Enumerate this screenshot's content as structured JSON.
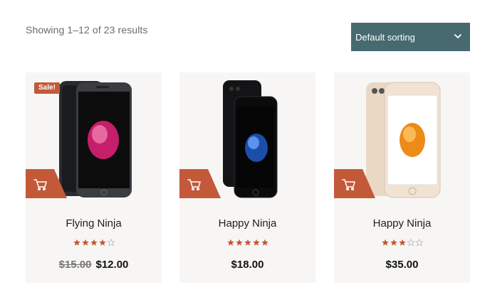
{
  "result_count": "Showing 1–12 of 23 results",
  "sort": {
    "selected": "Default sorting"
  },
  "colors": {
    "accent": "#c4593a",
    "sort_bg": "#476a70",
    "card_bg": "#f7f6f4"
  },
  "products": [
    {
      "name": "Flying Ninja",
      "sale_badge": "Sale!",
      "old_price": "$15.00",
      "price": "$12.00",
      "rating": 4,
      "phone": "black"
    },
    {
      "name": "Happy Ninja",
      "price": "$18.00",
      "rating": 5,
      "phone": "jet"
    },
    {
      "name": "Happy Ninja",
      "price": "$35.00",
      "rating": 3,
      "phone": "gold"
    }
  ]
}
